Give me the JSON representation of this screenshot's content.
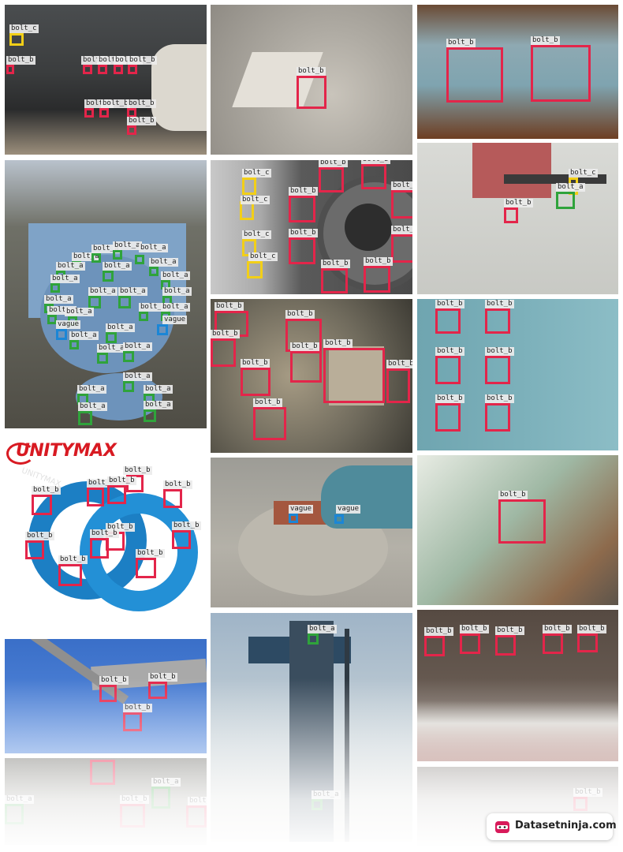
{
  "labels": {
    "bolt_a": "bolt_a",
    "bolt_b": "bolt_b",
    "bolt_c": "bolt_c",
    "vague": "vague"
  },
  "brand_logo": "UNITYMAX",
  "watermark": "UNITYMAX",
  "footer": {
    "site": "Datasetninja.com"
  },
  "colors": {
    "bolt_a": "#2fa33b",
    "bolt_b": "#e3254a",
    "bolt_c": "#f2cf18",
    "vague": "#1b86d6"
  },
  "tiles": [
    {
      "name": "truck-frame-bolts",
      "annotations": 13
    },
    {
      "name": "cone-bolt",
      "annotations": 1
    },
    {
      "name": "rusty-bolts",
      "annotations": 2
    },
    {
      "name": "blue-machine-bolts",
      "annotations": 40
    },
    {
      "name": "flange-bolts",
      "annotations": 14
    },
    {
      "name": "bracket-bolts",
      "annotations": 3
    },
    {
      "name": "hdr-bolts",
      "annotations": 9
    },
    {
      "name": "blue-wall-bolts",
      "annotations": 6
    },
    {
      "name": "wheel-spacer-bolts",
      "annotations": 11
    },
    {
      "name": "pipe-clamp",
      "annotations": 2
    },
    {
      "name": "green-plate-bolt",
      "annotations": 1
    },
    {
      "name": "truss-bolts",
      "annotations": 3
    },
    {
      "name": "pillar-bolts",
      "annotations": 2
    },
    {
      "name": "beam-bolts",
      "annotations": 5
    },
    {
      "name": "misc-bolts",
      "annotations": 5
    },
    {
      "name": "faded-bolt",
      "annotations": 1
    }
  ]
}
